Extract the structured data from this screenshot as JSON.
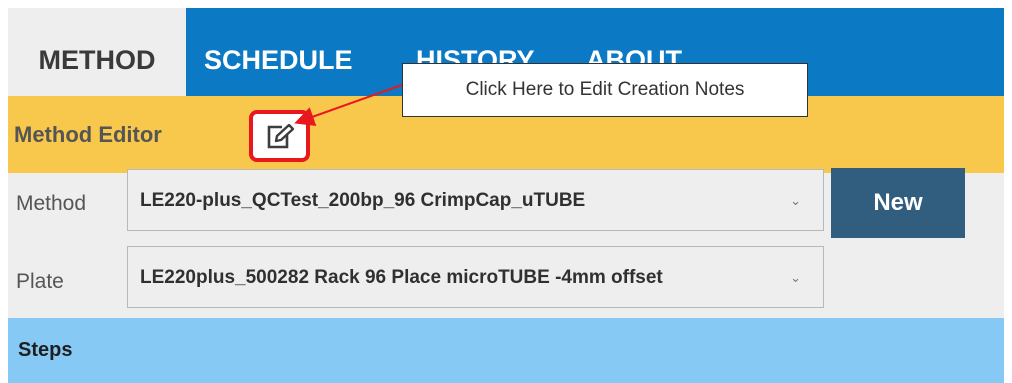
{
  "tabs": [
    {
      "label": "METHOD",
      "active": true
    },
    {
      "label": "SCHEDULE",
      "active": false
    },
    {
      "label": "HISTORY",
      "active": false
    },
    {
      "label": "ABOUT",
      "active": false
    }
  ],
  "editor": {
    "title": "Method Editor",
    "edit_icon": "edit-icon"
  },
  "method": {
    "label": "Method",
    "value": "LE220-plus_QCTest_200bp_96 CrimpCap_uTUBE",
    "new_label": "New"
  },
  "plate": {
    "label": "Plate",
    "value": "LE220plus_500282 Rack 96 Place microTUBE -4mm offset"
  },
  "steps": {
    "label": "Steps"
  },
  "callout": {
    "text": "Click Here to Edit Creation Notes"
  },
  "colors": {
    "tabbar": "#0c79c4",
    "editor_bar": "#f8c84d",
    "new_button": "#315d7e",
    "steps_bar": "#85c9f4",
    "highlight": "#e8181e"
  }
}
